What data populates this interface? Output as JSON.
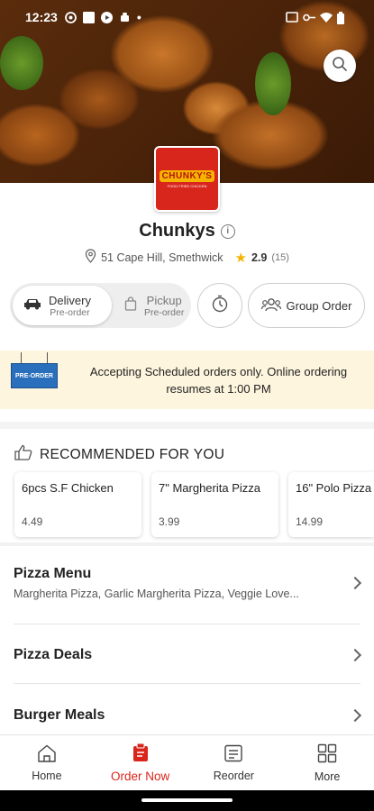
{
  "status_bar": {
    "time": "12:23"
  },
  "restaurant": {
    "logo_text": "CHUNKY'S",
    "logo_sub": "FOOD FRIED CHICKEN",
    "name": "Chunkys",
    "address": "51 Cape Hill, Smethwick",
    "rating": "2.9",
    "rating_count": "(15)"
  },
  "modes": {
    "delivery": {
      "label": "Delivery",
      "sub": "Pre-order"
    },
    "pickup": {
      "label": "Pickup",
      "sub": "Pre-order"
    },
    "group_order": "Group Order"
  },
  "banner": {
    "tag": "PRE-ORDER",
    "text": "Accepting Scheduled orders only. Online ordering resumes at 1:00 PM"
  },
  "recommended": {
    "heading": "RECOMMENDED FOR YOU",
    "items": [
      {
        "name": "6pcs S.F Chicken",
        "price": "4.49"
      },
      {
        "name": "7\" Margherita Pizza",
        "price": "3.99"
      },
      {
        "name": "16\" Polo Pizza",
        "price": "14.99"
      }
    ]
  },
  "menu": [
    {
      "title": "Pizza Menu",
      "desc": "Margherita Pizza, Garlic Margherita Pizza, Veggie Love..."
    },
    {
      "title": "Pizza Deals",
      "desc": ""
    },
    {
      "title": "Burger Meals",
      "desc": ""
    }
  ],
  "nav": {
    "home": "Home",
    "order_now": "Order Now",
    "reorder": "Reorder",
    "more": "More"
  },
  "colors": {
    "accent": "#d9261c",
    "banner_bg": "#fdf5de",
    "star": "#f4b400"
  }
}
